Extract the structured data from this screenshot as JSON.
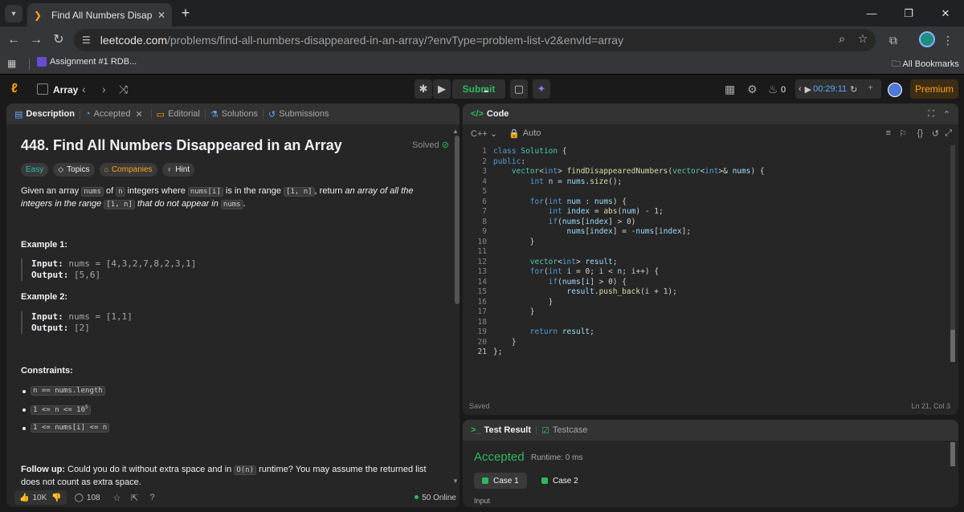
{
  "browser": {
    "tab_title": "Find All Numbers Disappeared",
    "url_host": "leetcode.com",
    "url_path": "/problems/find-all-numbers-disappeared-in-an-array/?envType=problem-list-v2&envId=array",
    "bookmark_1": "Assignment #1 RDB...",
    "all_bookmarks": "All Bookmarks"
  },
  "header": {
    "list_title": "Array",
    "submit_label": "Submit",
    "streak_count": "0",
    "timer": "00:29:11",
    "premium_label": "Premium"
  },
  "left_tabs": {
    "description": "Description",
    "accepted": "Accepted",
    "editorial": "Editorial",
    "solutions": "Solutions",
    "submissions": "Submissions"
  },
  "problem": {
    "title": "448. Find All Numbers Disappeared in an Array",
    "status": "Solved",
    "tags": [
      "Easy",
      "Topics",
      "Companies",
      "Hint"
    ],
    "example1_heading": "Example 1:",
    "example1_input": "nums = [4,3,2,7,8,2,3,1]",
    "example1_output": "[5,6]",
    "example2_heading": "Example 2:",
    "example2_input": "nums = [1,1]",
    "example2_output": "[2]",
    "input_label": "Input:",
    "output_label": "Output:",
    "constraints_heading": "Constraints:",
    "follow_up_label": "Follow up:",
    "follow_up_text_1": " Could you do it without extra space and in ",
    "follow_up_code": "O(n)",
    "follow_up_text_2": " runtime? You may assume the returned list does not count as extra space."
  },
  "footer": {
    "likes": "10K",
    "comments": "108",
    "online": "50 Online"
  },
  "code_panel": {
    "title": "Code",
    "language": "C++",
    "mode": "Auto",
    "saved": "Saved",
    "cursor": "Ln 21, Col 3"
  },
  "test_result": {
    "tab_result": "Test Result",
    "tab_testcase": "Testcase",
    "verdict": "Accepted",
    "runtime": "Runtime: 0 ms",
    "case1": "Case 1",
    "case2": "Case 2",
    "input_label": "Input"
  },
  "colors": {
    "accepted_green": "#2cbb5d",
    "leetcode_orange": "#ffa116",
    "easy_teal": "#2cb9ad"
  }
}
